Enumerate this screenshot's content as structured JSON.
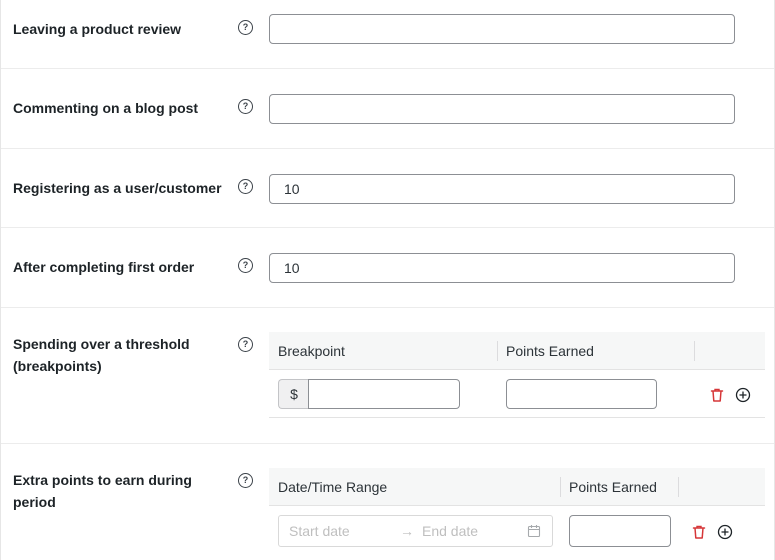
{
  "colors": {
    "trash": "#d63638",
    "text": "#1d2327",
    "border": "#8c8f94",
    "table_header_bg": "#f6f7f7"
  },
  "fields": {
    "product_review": {
      "label": "Leaving a product review",
      "value": ""
    },
    "blog_comment": {
      "label": "Commenting on a blog post",
      "value": ""
    },
    "registration": {
      "label": "Registering as a user/customer",
      "value": "10"
    },
    "first_order": {
      "label": "After completing first order",
      "value": "10"
    }
  },
  "help_glyph": "?",
  "threshold": {
    "label_line1": "Spending over a threshold",
    "label_line2": "(breakpoints)",
    "col_breakpoint": "Breakpoint",
    "col_points": "Points Earned",
    "currency": "$",
    "breakpoint_value": "",
    "points_value": "",
    "icons": [
      "trash-icon",
      "plus-circle-icon"
    ]
  },
  "period": {
    "label_line1": "Extra points to earn during",
    "label_line2": "period",
    "col_range": "Date/Time Range",
    "col_points": "Points Earned",
    "start_placeholder": "Start date",
    "arrow": "→",
    "end_placeholder": "End date",
    "points_value": "",
    "icons": [
      "trash-icon",
      "plus-circle-icon",
      "calendar-icon"
    ]
  }
}
